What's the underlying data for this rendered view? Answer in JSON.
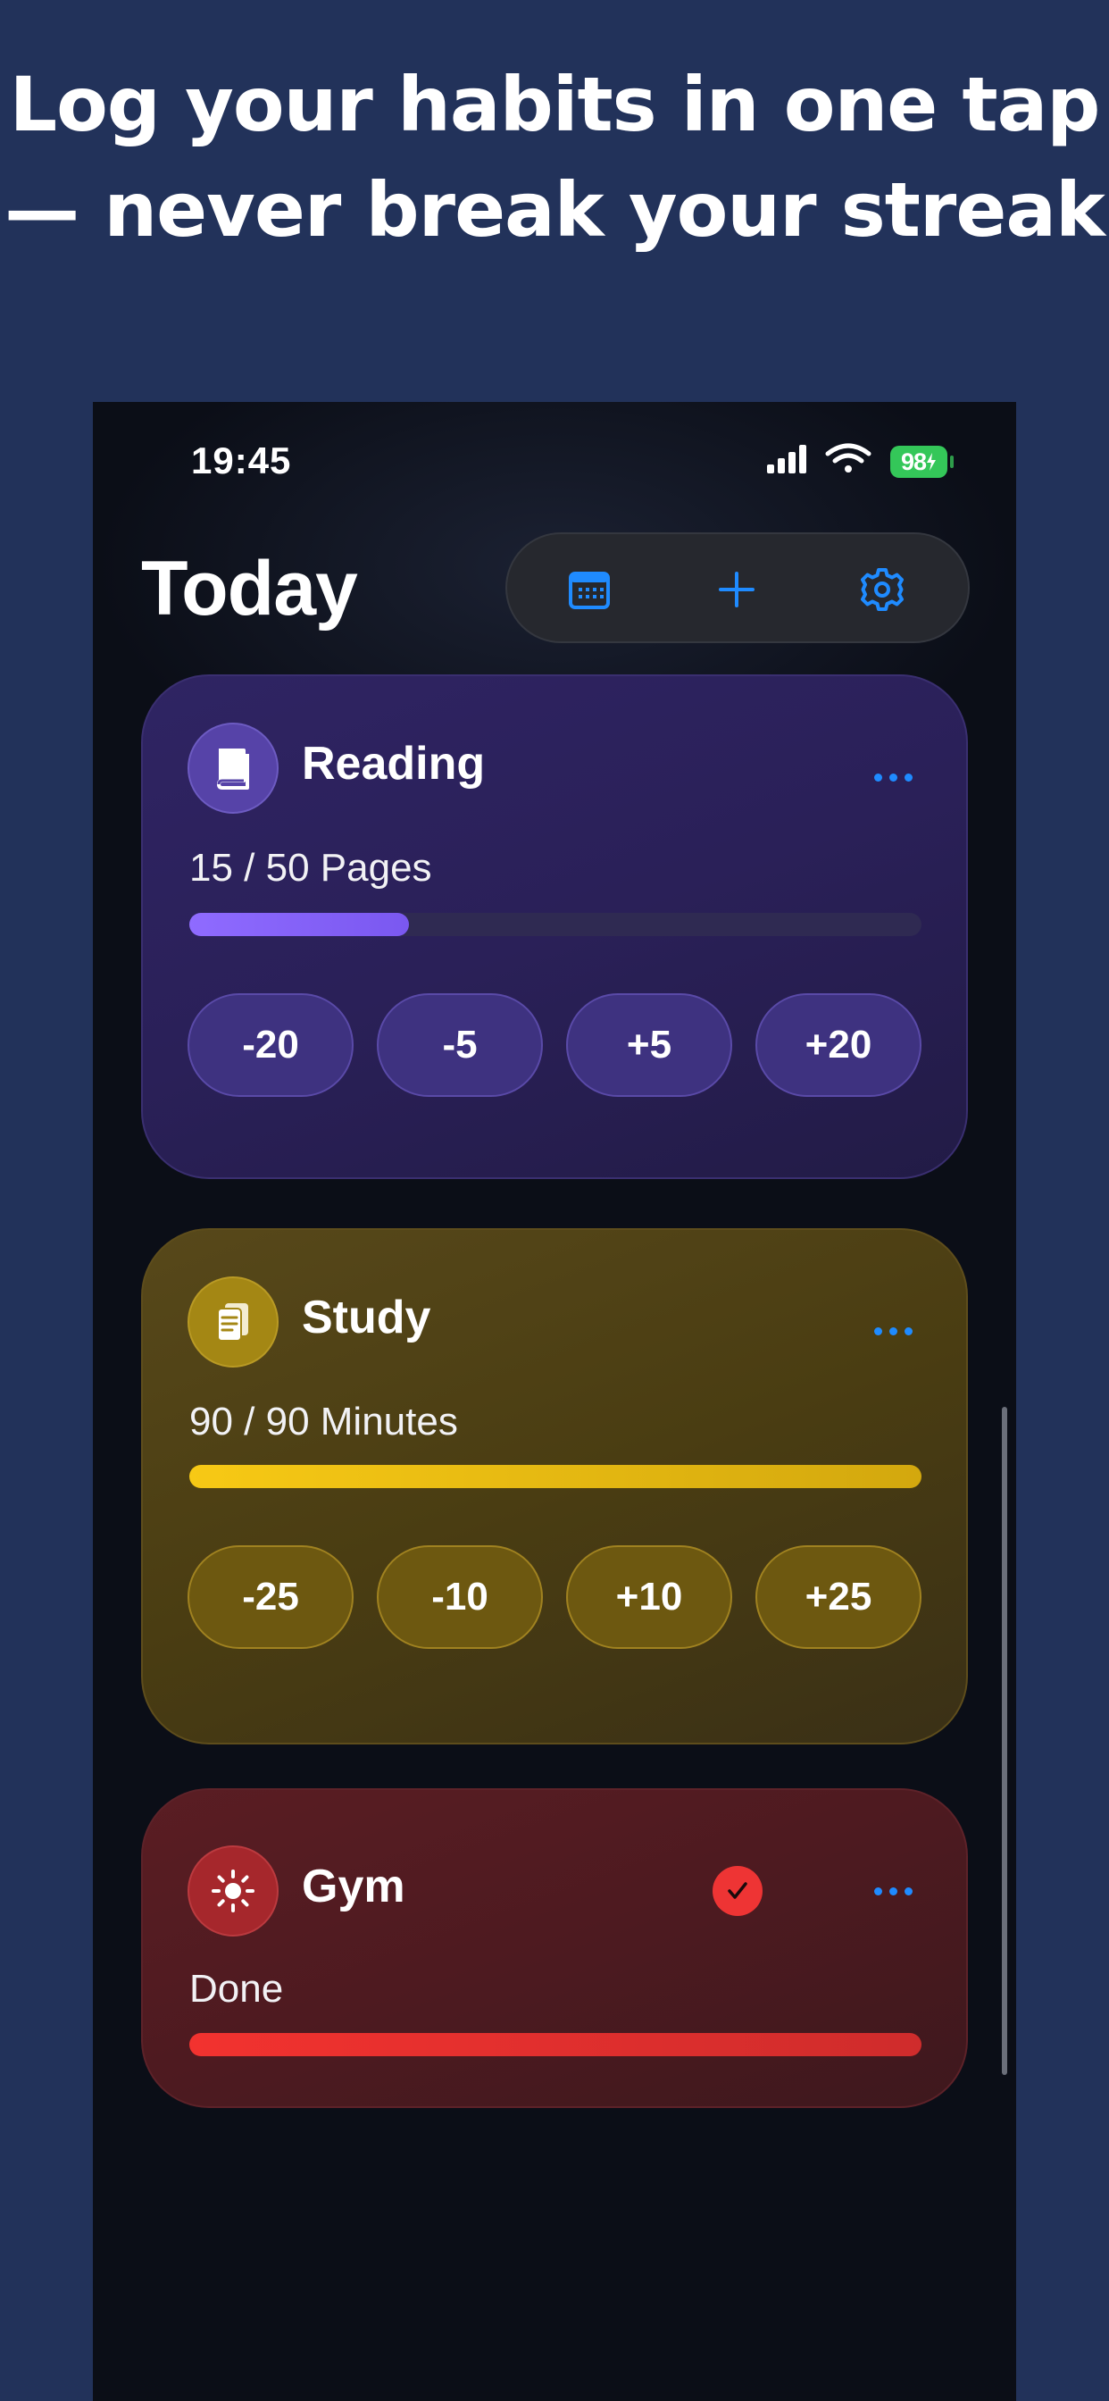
{
  "headline": {
    "line1": "Log your habits in one tap",
    "line2": "— never break your streak"
  },
  "status_bar": {
    "time": "19:45",
    "battery": "98"
  },
  "header": {
    "title": "Today",
    "toolbar": [
      "calendar-icon",
      "plus-icon",
      "gear-icon"
    ]
  },
  "colors": {
    "accent": "#1f8bff",
    "reading": "#7b5cff",
    "study": "#f5c518",
    "gym": "#ef3a3a"
  },
  "habits": [
    {
      "name": "Reading",
      "icon": "book-icon",
      "progress_text": "15 / 50 Pages",
      "progress_fraction": 0.3,
      "buttons": [
        "-20",
        "-5",
        "+5",
        "+20"
      ]
    },
    {
      "name": "Study",
      "icon": "notes-icon",
      "progress_text": "90 / 90 Minutes",
      "progress_fraction": 1.0,
      "buttons": [
        "-25",
        "-10",
        "+10",
        "+25"
      ]
    },
    {
      "name": "Gym",
      "icon": "sun-icon",
      "progress_text": "Done",
      "progress_fraction": 1.0,
      "completed": true
    }
  ]
}
